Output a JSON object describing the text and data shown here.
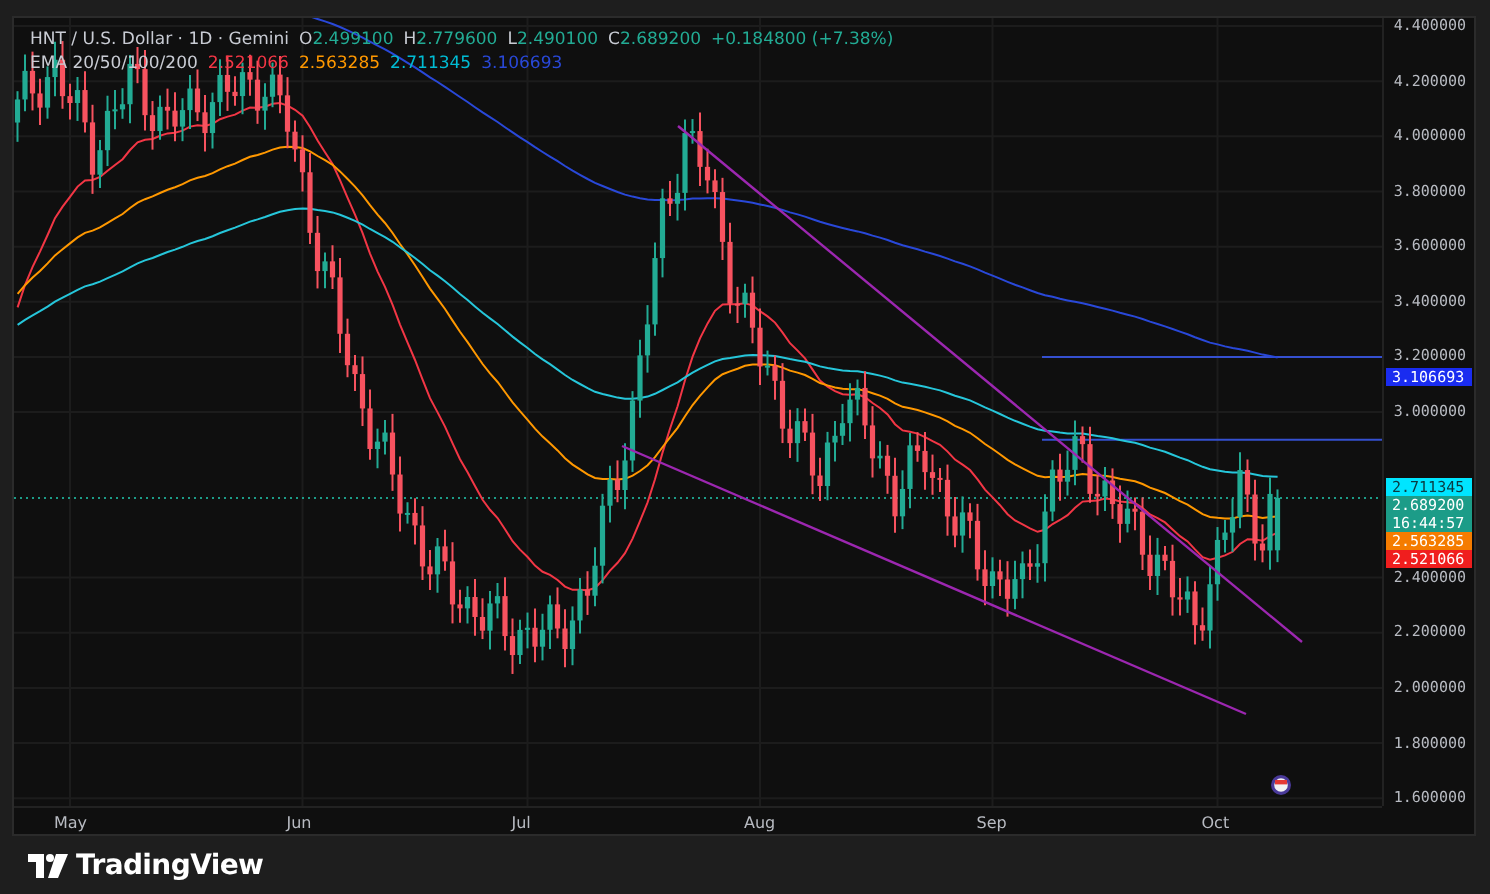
{
  "legend": {
    "symbol": "HNT / U.S. Dollar · 1D · Gemini",
    "ohlc": [
      {
        "label": "O",
        "value": "2.499100"
      },
      {
        "label": "H",
        "value": "2.779600"
      },
      {
        "label": "L",
        "value": "2.490100"
      },
      {
        "label": "C",
        "value": "2.689200"
      }
    ],
    "change": "+0.184800 (+7.38%)",
    "ema_label": "EMA 20/50/100/200",
    "ema_values": [
      {
        "value": "2.521066",
        "color": "#f23645"
      },
      {
        "value": "2.563285",
        "color": "#ff9800"
      },
      {
        "value": "2.711345",
        "color": "#00bcd4"
      },
      {
        "value": "3.106693",
        "color": "#2948d8"
      }
    ]
  },
  "y_axis": [
    "4.400000",
    "4.200000",
    "4.000000",
    "3.800000",
    "3.600000",
    "3.400000",
    "3.200000",
    "3.000000",
    "2.400000",
    "2.200000",
    "2.000000",
    "1.800000",
    "1.600000"
  ],
  "price_tags": [
    {
      "value": "3.106693",
      "color": "#1a2cf0"
    },
    {
      "value": "2.711345",
      "color": "#00e5ff"
    },
    {
      "value": "2.689200",
      "sub": "16:44:57",
      "color": "#1c9c88"
    },
    {
      "value": "2.563285",
      "color": "#f57c00"
    },
    {
      "value": "2.521066",
      "color": "#f01e1e"
    }
  ],
  "x_axis": [
    "May",
    "Jun",
    "Jul",
    "Aug",
    "Sep",
    "Oct"
  ],
  "footer": {
    "logo_text": "TradingView"
  }
}
